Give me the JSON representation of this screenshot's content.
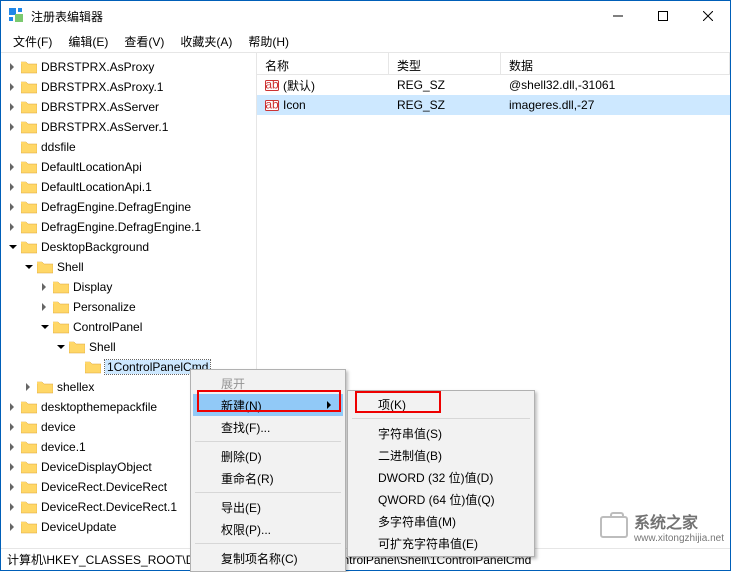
{
  "window": {
    "title": "注册表编辑器"
  },
  "menus": {
    "file": "文件(F)",
    "edit": "编辑(E)",
    "view": "查看(V)",
    "favorites": "收藏夹(A)",
    "help": "帮助(H)"
  },
  "tree": {
    "items": [
      {
        "d": 1,
        "tw": "closed",
        "label": "DBRSTPRX.AsProxy"
      },
      {
        "d": 1,
        "tw": "closed",
        "label": "DBRSTPRX.AsProxy.1"
      },
      {
        "d": 1,
        "tw": "closed",
        "label": "DBRSTPRX.AsServer"
      },
      {
        "d": 1,
        "tw": "closed",
        "label": "DBRSTPRX.AsServer.1"
      },
      {
        "d": 1,
        "tw": "none",
        "label": "ddsfile"
      },
      {
        "d": 1,
        "tw": "closed",
        "label": "DefaultLocationApi"
      },
      {
        "d": 1,
        "tw": "closed",
        "label": "DefaultLocationApi.1"
      },
      {
        "d": 1,
        "tw": "closed",
        "label": "DefragEngine.DefragEngine"
      },
      {
        "d": 1,
        "tw": "closed",
        "label": "DefragEngine.DefragEngine.1"
      },
      {
        "d": 1,
        "tw": "open",
        "label": "DesktopBackground"
      },
      {
        "d": 2,
        "tw": "open",
        "label": "Shell"
      },
      {
        "d": 3,
        "tw": "closed",
        "label": "Display"
      },
      {
        "d": 3,
        "tw": "closed",
        "label": "Personalize"
      },
      {
        "d": 3,
        "tw": "open",
        "label": "ControlPanel"
      },
      {
        "d": 4,
        "tw": "open",
        "label": "Shell"
      },
      {
        "d": 5,
        "tw": "none",
        "label": "1ControlPanelCmd",
        "sel": true
      },
      {
        "d": 2,
        "tw": "closed",
        "label": "shellex"
      },
      {
        "d": 1,
        "tw": "closed",
        "label": "desktopthemepackfile"
      },
      {
        "d": 1,
        "tw": "closed",
        "label": "device"
      },
      {
        "d": 1,
        "tw": "closed",
        "label": "device.1"
      },
      {
        "d": 1,
        "tw": "closed",
        "label": "DeviceDisplayObject"
      },
      {
        "d": 1,
        "tw": "closed",
        "label": "DeviceRect.DeviceRect"
      },
      {
        "d": 1,
        "tw": "closed",
        "label": "DeviceRect.DeviceRect.1"
      },
      {
        "d": 1,
        "tw": "closed",
        "label": "DeviceUpdate"
      }
    ]
  },
  "columns": {
    "name": "名称",
    "type": "类型",
    "data": "数据"
  },
  "rows": [
    {
      "name": "(默认)",
      "type": "REG_SZ",
      "data": "@shell32.dll,-31061"
    },
    {
      "name": "Icon",
      "type": "REG_SZ",
      "data": "imageres.dll,-27",
      "sel": true
    }
  ],
  "ctx1": {
    "expand": "展开",
    "new": "新建(N)",
    "find": "查找(F)...",
    "delete": "删除(D)",
    "rename": "重命名(R)",
    "export": "导出(E)",
    "perm": "权限(P)...",
    "copykey": "复制项名称(C)"
  },
  "ctx2": {
    "key": "项(K)",
    "string": "字符串值(S)",
    "binary": "二进制值(B)",
    "dword": "DWORD (32 位)值(D)",
    "qword": "QWORD (64 位)值(Q)",
    "multi": "多字符串值(M)",
    "expand": "可扩充字符串值(E)"
  },
  "status": "计算机\\HKEY_CLASSES_ROOT\\DesktopBackground\\Shell\\ControlPanel\\Shell\\1ControlPanelCmd",
  "watermark": {
    "text": "系统之家",
    "url": "www.xitongzhijia.net"
  }
}
